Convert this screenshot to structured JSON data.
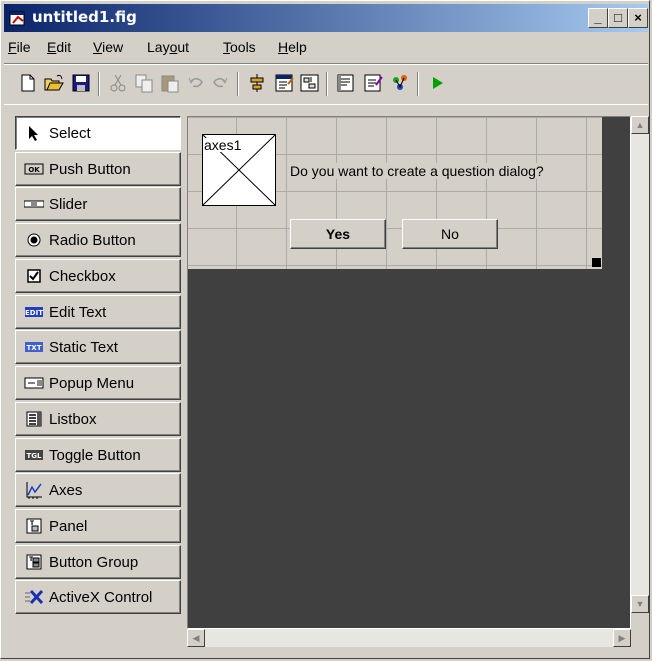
{
  "window": {
    "title": "untitled1.fig",
    "controls": [
      "_",
      "□",
      "×"
    ]
  },
  "menubar": {
    "items": [
      {
        "label": "File",
        "accel": "F",
        "rest": "ile"
      },
      {
        "label": "Edit",
        "accel": "E",
        "rest": "dit"
      },
      {
        "label": "View",
        "accel": "V",
        "rest": "iew"
      },
      {
        "label": "Layout",
        "pre": "Lay",
        "accel": "o",
        "rest": "ut"
      },
      {
        "label": "Tools",
        "accel": "T",
        "rest": "ools"
      },
      {
        "label": "Help",
        "accel": "H",
        "rest": "elp"
      }
    ]
  },
  "toolbar": {
    "icons": [
      "new-icon",
      "open-icon",
      "save-icon",
      "cut-icon",
      "copy-icon",
      "paste-icon",
      "undo-icon",
      "redo-icon",
      "align-icon",
      "menu-editor-icon",
      "tab-order-icon",
      "mfile-editor-icon",
      "property-inspector-icon",
      "object-browser-icon",
      "run-icon"
    ]
  },
  "palette": {
    "items": [
      {
        "label": "Select",
        "icon": "arrow-icon",
        "selected": true
      },
      {
        "label": "Push Button",
        "icon": "pushbutton-icon"
      },
      {
        "label": "Slider",
        "icon": "slider-icon"
      },
      {
        "label": "Radio Button",
        "icon": "radio-icon"
      },
      {
        "label": "Checkbox",
        "icon": "checkbox-icon"
      },
      {
        "label": "Edit Text",
        "icon": "edittext-icon"
      },
      {
        "label": "Static Text",
        "icon": "statictext-icon"
      },
      {
        "label": "Popup Menu",
        "icon": "popup-icon"
      },
      {
        "label": "Listbox",
        "icon": "listbox-icon"
      },
      {
        "label": "Toggle Button",
        "icon": "toggle-icon"
      },
      {
        "label": "Axes",
        "icon": "axes-icon"
      },
      {
        "label": "Panel",
        "icon": "panel-icon"
      },
      {
        "label": "Button Group",
        "icon": "buttongroup-icon"
      },
      {
        "label": "ActiveX Control",
        "icon": "activex-icon"
      }
    ]
  },
  "figure": {
    "axes_label": "axes1",
    "question": "Do you want to create a question dialog?",
    "yes_label": "Yes",
    "no_label": "No"
  }
}
